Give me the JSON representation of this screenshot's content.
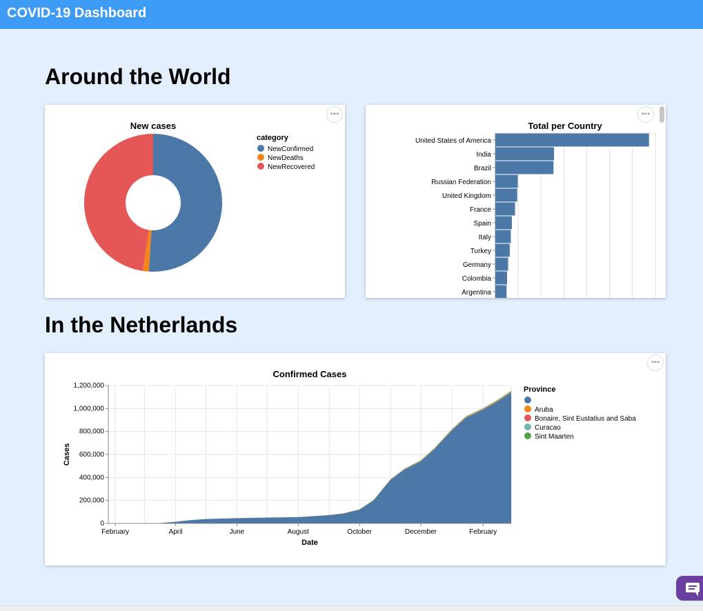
{
  "app": {
    "title": "COVID-19 Dashboard"
  },
  "sections": {
    "world": "Around the World",
    "netherlands": "In the Netherlands"
  },
  "menu_glyph": "•••",
  "icons": {
    "menu": "ellipsis-icon",
    "chat": "chat-bubble-icon"
  },
  "colors": {
    "accent": "#3d9bf5",
    "background": "#e3effd",
    "bar": "#4c78a8",
    "chat": "#6b3fa0"
  },
  "chart_data": [
    {
      "id": "new_cases",
      "type": "pie",
      "title": "New cases",
      "donut": true,
      "legend_title": "category",
      "legend_position": "right",
      "labels": [
        "NewConfirmed",
        "NewDeaths",
        "NewRecovered"
      ],
      "values": [
        51,
        1.4,
        47.6
      ],
      "colors": [
        "#4c78a8",
        "#f58518",
        "#e45756"
      ]
    },
    {
      "id": "total_per_country",
      "type": "bar",
      "orientation": "horizontal",
      "title": "Total per Country",
      "categories": [
        "United States of America",
        "India",
        "Brazil",
        "Russian Federation",
        "United Kingdom",
        "France",
        "Spain",
        "Italy",
        "Turkey",
        "Germany",
        "Colombia",
        "Argentina"
      ],
      "values": [
        28800000,
        11000000,
        10900000,
        4200000,
        4100000,
        3700000,
        3100000,
        2900000,
        2700000,
        2400000,
        2200000,
        2100000
      ],
      "xlim": [
        0,
        30000000
      ],
      "grid": true,
      "color": "#4c78a8"
    },
    {
      "id": "confirmed_cases",
      "type": "area",
      "title": "Confirmed Cases",
      "xlabel": "Date",
      "ylabel": "Cases",
      "ylim": [
        0,
        1200000
      ],
      "y_ticks": [
        "0",
        "200,000",
        "400,000",
        "600,000",
        "800,000",
        "1,000,000",
        "1,200,000"
      ],
      "x_ticks": [
        "February",
        "April",
        "June",
        "August",
        "October",
        "December",
        "February"
      ],
      "grid": true,
      "legend_title": "Province",
      "legend_position": "right",
      "series": [
        {
          "name": "",
          "color": "#4c78a8",
          "x": [
            "2020-02-01",
            "2020-03-01",
            "2020-03-15",
            "2020-04-01",
            "2020-04-15",
            "2020-05-01",
            "2020-06-01",
            "2020-07-01",
            "2020-08-01",
            "2020-08-15",
            "2020-09-01",
            "2020-09-15",
            "2020-10-01",
            "2020-10-15",
            "2020-11-01",
            "2020-11-15",
            "2020-12-01",
            "2020-12-15",
            "2021-01-01",
            "2021-01-15",
            "2021-02-01",
            "2021-02-15",
            "2021-03-01"
          ],
          "values": [
            0,
            0,
            2000,
            14000,
            28000,
            38000,
            46000,
            51000,
            55000,
            62000,
            72000,
            86000,
            120000,
            200000,
            380000,
            470000,
            540000,
            650000,
            810000,
            920000,
            990000,
            1060000,
            1140000
          ]
        },
        {
          "name": "Aruba",
          "color": "#f58518",
          "x": [
            "2020-02-01",
            "2020-08-01",
            "2020-10-01",
            "2020-12-01",
            "2021-03-01"
          ],
          "values": [
            0,
            200,
            2000,
            5000,
            7000
          ]
        },
        {
          "name": "Bonaire, Sint Eustatius and Saba",
          "color": "#e45756",
          "x": [
            "2020-02-01",
            "2020-08-01",
            "2020-10-01",
            "2020-12-01",
            "2021-03-01"
          ],
          "values": [
            0,
            0,
            100,
            200,
            300
          ]
        },
        {
          "name": "Curacao",
          "color": "#72b7b2",
          "x": [
            "2020-02-01",
            "2020-08-01",
            "2020-10-01",
            "2020-12-01",
            "2021-03-01"
          ],
          "values": [
            0,
            100,
            500,
            4000,
            6000
          ]
        },
        {
          "name": "Sint Maarten",
          "color": "#54a24b",
          "x": [
            "2020-02-01",
            "2020-08-01",
            "2020-10-01",
            "2020-12-01",
            "2021-03-01"
          ],
          "values": [
            0,
            100,
            500,
            1200,
            1700
          ]
        }
      ]
    }
  ]
}
